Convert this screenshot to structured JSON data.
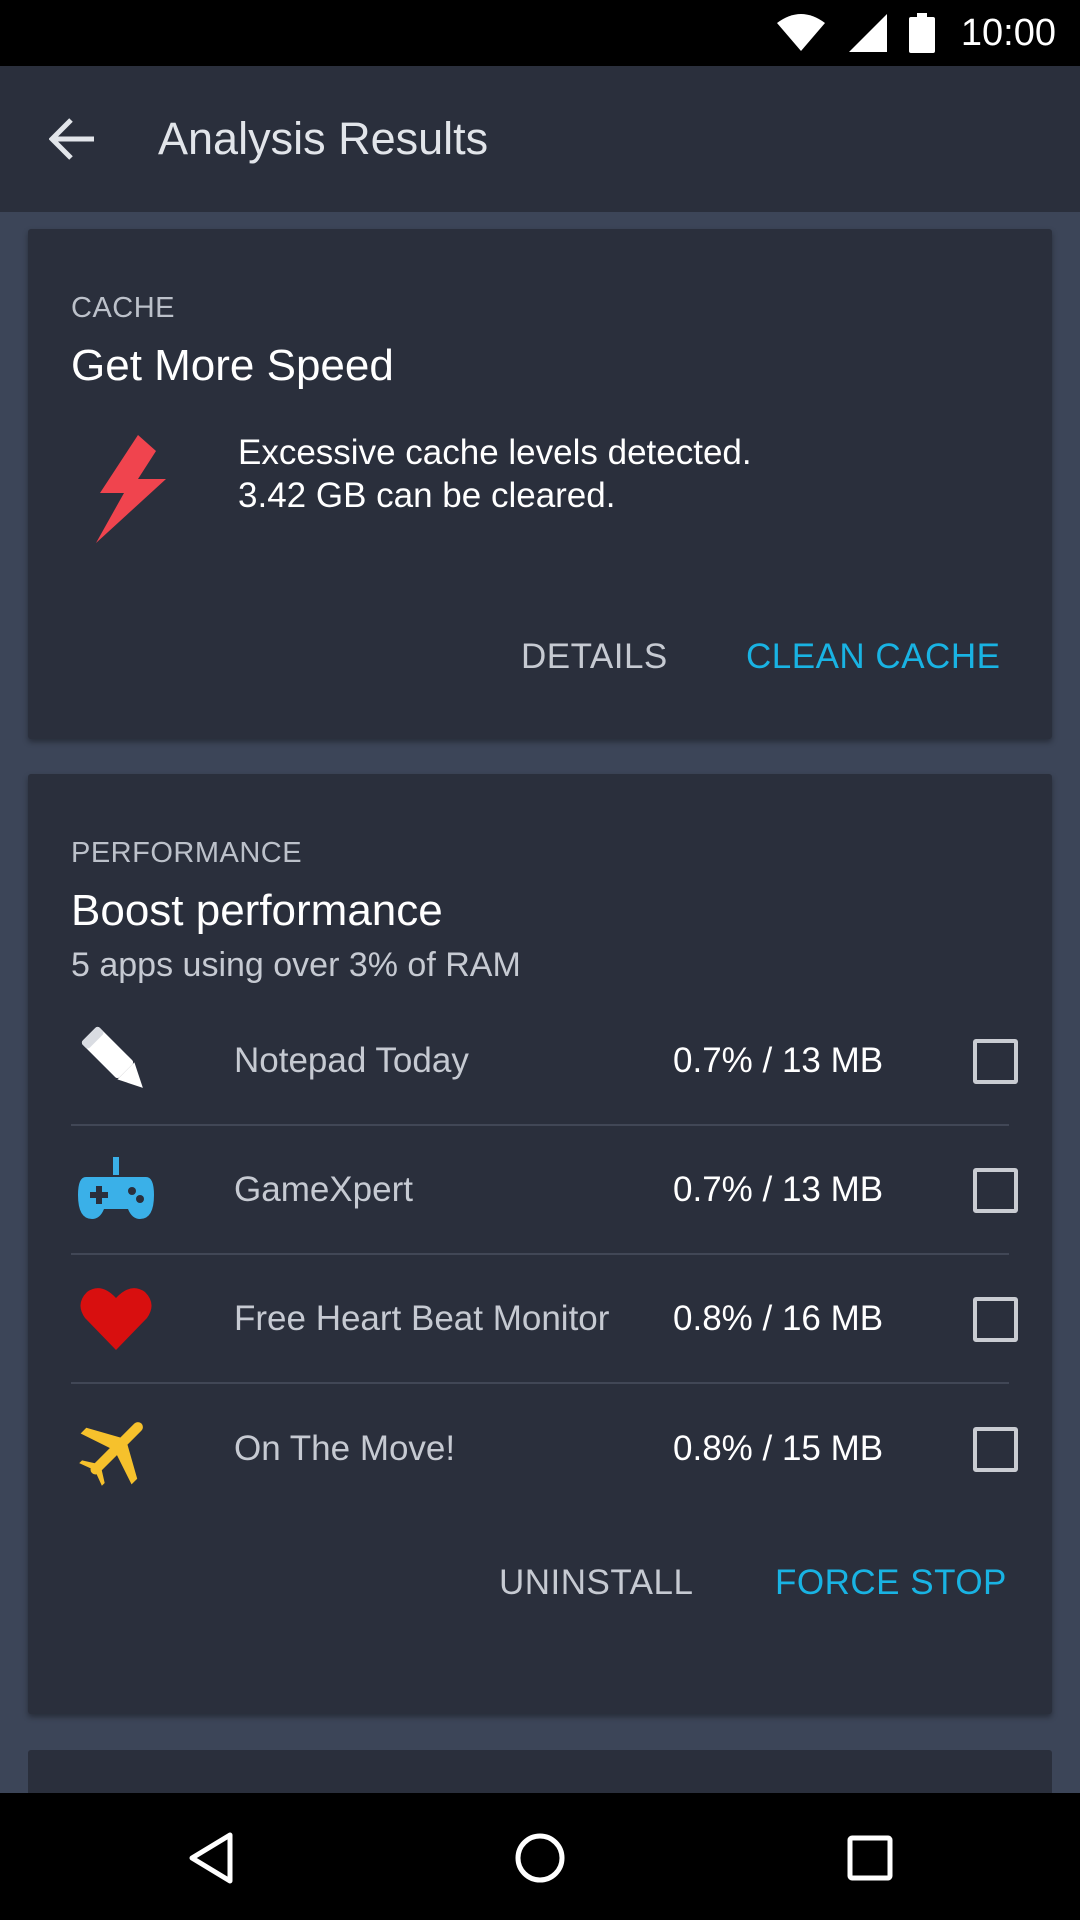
{
  "status_bar": {
    "time": "10:00",
    "icons": [
      "wifi-icon",
      "signal-icon",
      "battery-icon"
    ]
  },
  "app_bar": {
    "title": "Analysis Results",
    "back_icon": "arrow-back-icon"
  },
  "cache_card": {
    "label": "CACHE",
    "title": "Get More Speed",
    "icon": "lightning-bolt-icon",
    "description_line1": "Excessive cache levels detected.",
    "description_line2": "3.42 GB can be cleared.",
    "details_button": "DETAILS",
    "clean_button": "CLEAN CACHE"
  },
  "performance_card": {
    "label": "PERFORMANCE",
    "title": "Boost performance",
    "subtitle": "5 apps using over 3% of RAM",
    "apps": [
      {
        "name": "Notepad Today",
        "usage": "0.7% / 13 MB",
        "icon": "pencil-icon",
        "checked": false
      },
      {
        "name": "GameXpert",
        "usage": "0.7% / 13 MB",
        "icon": "gamepad-icon",
        "checked": false
      },
      {
        "name": "Free Heart Beat Monitor",
        "usage": "0.8% / 16 MB",
        "icon": "heart-icon",
        "checked": false
      },
      {
        "name": "On The Move!",
        "usage": "0.8% / 15 MB",
        "icon": "airplane-icon",
        "checked": false
      }
    ],
    "uninstall_button": "UNINSTALL",
    "force_stop_button": "FORCE STOP"
  },
  "colors": {
    "accent": "#19b3e3",
    "card_bg": "#2a2f3c",
    "page_bg": "#3c4558",
    "bolt": "#f0444e",
    "gamepad": "#3ab0e8",
    "heart": "#d80f0f",
    "airplane": "#f6c12c"
  },
  "nav_bar": {
    "icons": [
      "back-triangle-icon",
      "home-circle-icon",
      "recents-square-icon"
    ]
  }
}
